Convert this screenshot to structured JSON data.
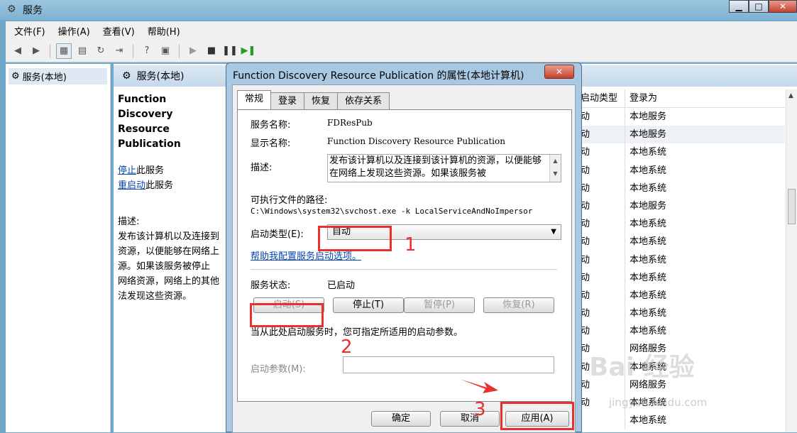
{
  "window": {
    "title": "服务",
    "min": "▁",
    "max": "□",
    "close": "✕"
  },
  "menu": [
    "文件(F)",
    "操作(A)",
    "查看(V)",
    "帮助(H)"
  ],
  "tree": {
    "root": "服务(本地)"
  },
  "content": {
    "header": "服务(本地)",
    "service_title": "Function Discovery Resource Publication",
    "stop_link": "停止",
    "stop_suffix": "此服务",
    "restart_link": "重启动",
    "restart_suffix": "此服务",
    "desc_label": "描述:",
    "desc_lines": [
      "发布该计算机以及连接到",
      "资源，以便能够在网络上",
      "源。如果该服务被停止",
      "网络资源，网络上的其他",
      "法发现这些资源。"
    ]
  },
  "list": {
    "col_starttype": "启动类型",
    "col_logon": "登录为",
    "starttype_rows": [
      "动",
      "动",
      "动",
      "动",
      "动",
      "动",
      "动",
      "动",
      "动",
      "动",
      "动",
      "动",
      "动",
      "动",
      "动",
      "动",
      "动"
    ],
    "logon_rows": [
      "本地服务",
      "本地服务",
      "本地系统",
      "本地系统",
      "本地系统",
      "本地服务",
      "本地系统",
      "本地系统",
      "本地系统",
      "本地系统",
      "本地系统",
      "本地系统",
      "本地系统",
      "网络服务",
      "本地系统",
      "网络服务",
      "本地系统",
      "本地系统"
    ]
  },
  "dialog": {
    "title": "Function Discovery Resource Publication 的属性(本地计算机)",
    "close": "✕",
    "tabs": [
      "常规",
      "登录",
      "恢复",
      "依存关系"
    ],
    "service_name_label": "服务名称:",
    "service_name": "FDResPub",
    "display_name_label": "显示名称:",
    "display_name": "Function Discovery Resource Publication",
    "description_label": "描述:",
    "description": "发布该计算机以及连接到该计算机的资源，以便能够在网络上发现这些资源。如果该服务被",
    "path_label": "可执行文件的路径:",
    "path": "C:\\Windows\\system32\\svchost.exe -k LocalServiceAndNoImpersor",
    "startup_type_label": "启动类型(E):",
    "startup_type": "自动",
    "help_link": "帮助我配置服务启动选项。",
    "status_label": "服务状态:",
    "status": "已启动",
    "btn_start": "启动(S)",
    "btn_stop": "停止(T)",
    "btn_pause": "暂停(P)",
    "btn_resume": "恢复(R)",
    "hint": "当从此处启动服务时，您可指定所适用的启动参数。",
    "param_label": "启动参数(M):",
    "btn_ok": "确定",
    "btn_cancel": "取消",
    "btn_apply": "应用(A)"
  },
  "annotations": {
    "n1": "1",
    "n2": "2",
    "n3": "3",
    "color": "#e8302c"
  },
  "watermark": {
    "text": "Bai 经验",
    "sub": "jingyan.baidu.com"
  }
}
